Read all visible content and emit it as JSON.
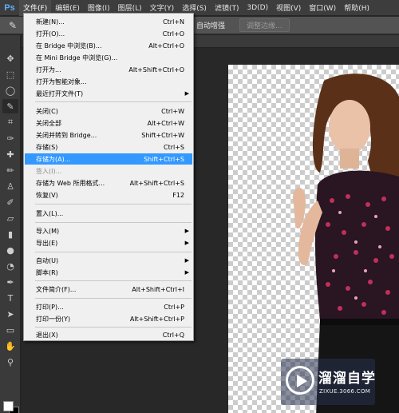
{
  "app": {
    "logo_text": "Ps"
  },
  "menubar": {
    "items": [
      {
        "label": "文件(F)"
      },
      {
        "label": "编辑(E)"
      },
      {
        "label": "图像(I)"
      },
      {
        "label": "图层(L)"
      },
      {
        "label": "文字(Y)"
      },
      {
        "label": "选择(S)"
      },
      {
        "label": "滤镜(T)"
      },
      {
        "label": "3D(D)"
      },
      {
        "label": "视图(V)"
      },
      {
        "label": "窗口(W)"
      },
      {
        "label": "帮助(H)"
      }
    ]
  },
  "options_bar": {
    "auto_enhance": "自动增强",
    "refine_edge": "调整边缘..."
  },
  "file_menu": {
    "items": [
      {
        "label": "新建(N)...",
        "shortcut": "Ctrl+N"
      },
      {
        "label": "打开(O)...",
        "shortcut": "Ctrl+O"
      },
      {
        "label": "在 Bridge 中浏览(B)...",
        "shortcut": "Alt+Ctrl+O"
      },
      {
        "label": "在 Mini Bridge 中浏览(G)...",
        "shortcut": ""
      },
      {
        "label": "打开为...",
        "shortcut": "Alt+Shift+Ctrl+O"
      },
      {
        "label": "打开为智能对象...",
        "shortcut": ""
      },
      {
        "label": "最近打开文件(T)",
        "shortcut": ""
      },
      {
        "label": "关闭(C)",
        "shortcut": "Ctrl+W"
      },
      {
        "label": "关闭全部",
        "shortcut": "Alt+Ctrl+W"
      },
      {
        "label": "关闭并转到 Bridge...",
        "shortcut": "Shift+Ctrl+W"
      },
      {
        "label": "存储(S)",
        "shortcut": "Ctrl+S"
      },
      {
        "label": "存储为(A)...",
        "shortcut": "Shift+Ctrl+S"
      },
      {
        "label": "签入(I)...",
        "shortcut": ""
      },
      {
        "label": "存储为 Web 所用格式...",
        "shortcut": "Alt+Shift+Ctrl+S"
      },
      {
        "label": "恢复(V)",
        "shortcut": "F12"
      },
      {
        "label": "置入(L)...",
        "shortcut": ""
      },
      {
        "label": "导入(M)",
        "shortcut": ""
      },
      {
        "label": "导出(E)",
        "shortcut": ""
      },
      {
        "label": "自动(U)",
        "shortcut": ""
      },
      {
        "label": "脚本(R)",
        "shortcut": ""
      },
      {
        "label": "文件简介(F)...",
        "shortcut": "Alt+Shift+Ctrl+I"
      },
      {
        "label": "打印(P)...",
        "shortcut": "Ctrl+P"
      },
      {
        "label": "打印一份(Y)",
        "shortcut": "Alt+Shift+Ctrl+P"
      },
      {
        "label": "退出(X)",
        "shortcut": "Ctrl+Q"
      }
    ]
  },
  "watermark": {
    "name": "溜溜自学",
    "url": "ZIXUE.3066.COM"
  },
  "colors": {
    "highlight": "#3399ff",
    "menubar": "#3d3d3d",
    "workspace": "#282828"
  }
}
